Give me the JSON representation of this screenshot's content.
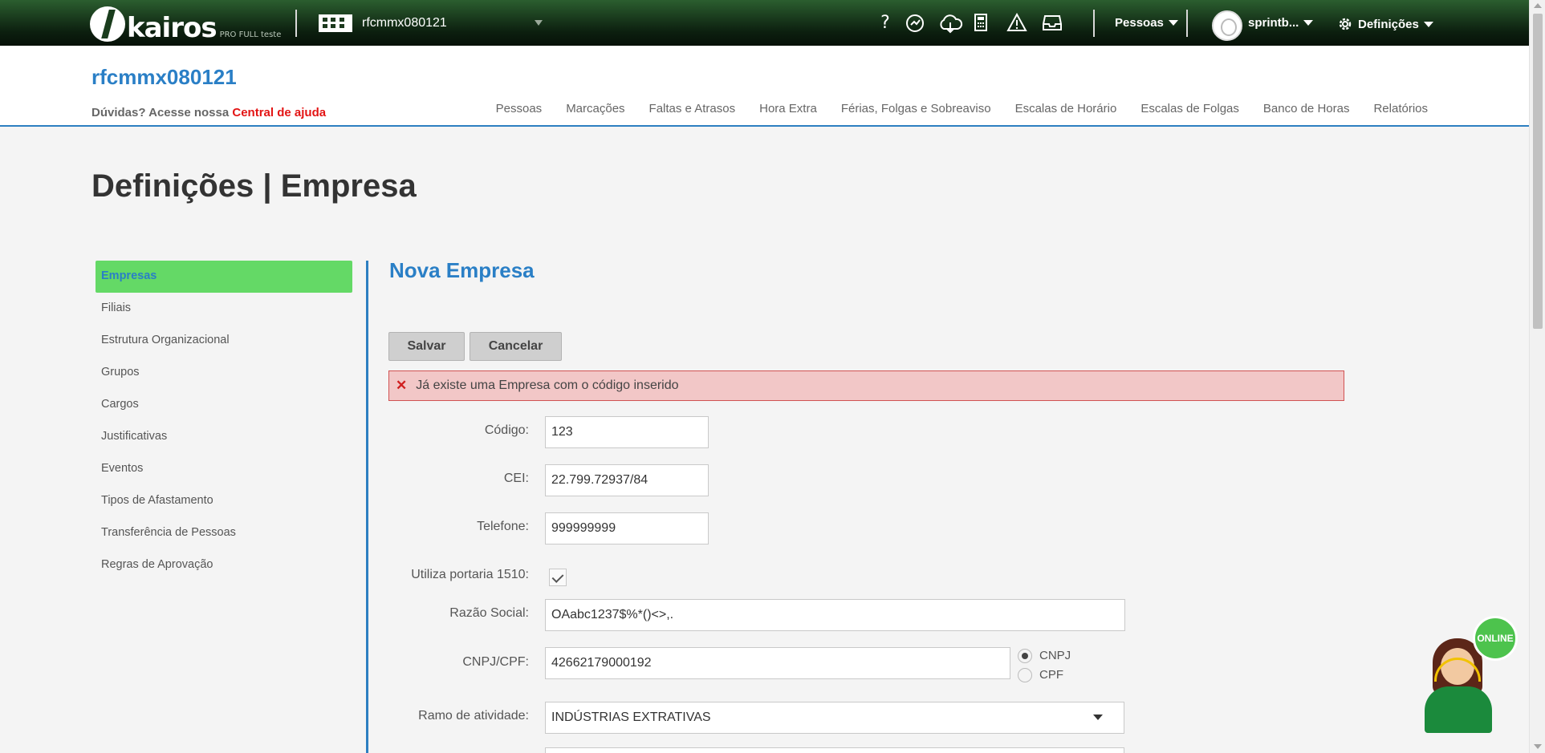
{
  "topbar": {
    "logo_text": "kairos",
    "logo_sub": "PRO FULL teste",
    "company_name": "rfcmmx080121",
    "icons": [
      "help-icon",
      "support-icon",
      "cloud-download-icon",
      "calculator-icon",
      "warning-icon",
      "inbox-icon"
    ],
    "people_menu": "Pessoas",
    "user_name": "sprintb...",
    "settings_menu": "Definições"
  },
  "header": {
    "title": "rfcmmx080121",
    "help_prefix": "Dúvidas? Acesse nossa",
    "help_link": "Central de ajuda",
    "nav": [
      "Pessoas",
      "Marcações",
      "Faltas e Atrasos",
      "Hora Extra",
      "Férias, Folgas e Sobreaviso",
      "Escalas de Horário",
      "Escalas de Folgas",
      "Banco de Horas",
      "Relatórios"
    ]
  },
  "page": {
    "title": "Definições | Empresa"
  },
  "sidebar": {
    "items": [
      {
        "label": "Empresas",
        "active": true
      },
      {
        "label": "Filiais"
      },
      {
        "label": "Estrutura Organizacional"
      },
      {
        "label": "Grupos"
      },
      {
        "label": "Cargos"
      },
      {
        "label": "Justificativas"
      },
      {
        "label": "Eventos"
      },
      {
        "label": "Tipos de Afastamento"
      },
      {
        "label": "Transferência de Pessoas"
      },
      {
        "label": "Regras de Aprovação"
      }
    ]
  },
  "form": {
    "title": "Nova Empresa",
    "save_label": "Salvar",
    "cancel_label": "Cancelar",
    "error": "Já existe uma Empresa com o código inserido",
    "codigo_label": "Código:",
    "codigo_value": "123",
    "cei_label": "CEI:",
    "cei_value": "22.799.72937/84",
    "telefone_label": "Telefone:",
    "telefone_value": "999999999",
    "portaria_label": "Utiliza portaria 1510:",
    "portaria_checked": true,
    "razao_label": "Razão Social:",
    "razao_value": "OAabc1237$%*()<>,.",
    "cnpj_label": "CNPJ/CPF:",
    "cnpj_value": "42662179000192",
    "doc_type_options": [
      "CNPJ",
      "CPF"
    ],
    "doc_type_selected": "CNPJ",
    "ramo_label": "Ramo de atividade:",
    "ramo_value": "INDÚSTRIAS EXTRATIVAS"
  },
  "chat": {
    "status": "ONLINE"
  }
}
